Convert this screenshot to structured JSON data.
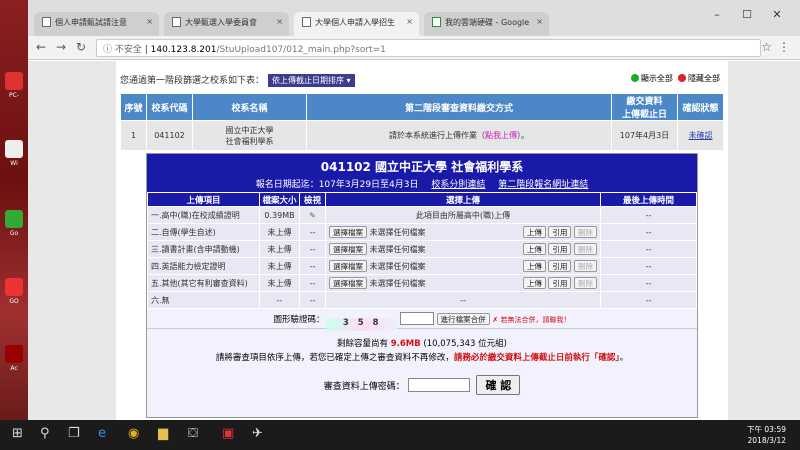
{
  "tabs": [
    {
      "label": "個人申請甄試請注意"
    },
    {
      "label": "大學甄選入學委員會"
    },
    {
      "label": "大學個人申請入學招生"
    },
    {
      "label": "我的雲端硬碟 - Google"
    }
  ],
  "address": {
    "warn": "ⓘ 不安全",
    "host": "140.123.8.201",
    "path": "/StuUpload107/012_main.php?sort=1"
  },
  "topline": {
    "text": "您通過第一階段篩選之校系如下表：",
    "sort": "依上傳截止日期排序 ▾"
  },
  "legend": {
    "show_all": "顯示全部",
    "hide_all": "隱藏全部",
    "show_color": "#22aa22",
    "hide_color": "#dd2222"
  },
  "schools": {
    "headers": [
      "序號",
      "校系代碼",
      "校系名稱",
      "第二階段審查資料繳交方式",
      "繳交資料\n上傳截止日",
      "確認狀態"
    ],
    "row": {
      "no": "1",
      "code": "041102",
      "name1": "國立中正大學",
      "name2": "社會福利學系",
      "method": "請於本系統進行上傳作業（",
      "method_link": "點我上傳",
      "method_end": "）。",
      "deadline": "107年4月3日",
      "status": "未確認"
    }
  },
  "detail": {
    "title": "041102 國立中正大學 社會福利學系",
    "subtitle": "報名日期起迄：107年3月29日至4月3日",
    "link1": "校系分則連結",
    "link2": "第二階段報名網址連結",
    "headers": [
      "上傳項目",
      "檔案大小",
      "檢視",
      "選擇上傳",
      "最後上傳時間"
    ],
    "rows": [
      {
        "item": "一.高中(職)在校成績證明",
        "size": "0.39MB",
        "view": "✎",
        "choose": "此項目由所屬高中(職)上傳",
        "time": "--"
      },
      {
        "item": "二.自傳(學生自述)",
        "size": "未上傳",
        "view": "--",
        "choose": "選擇檔案",
        "nofile": "未選擇任何檔案",
        "upload": "上傳",
        "cite": "引用",
        "del": "刪除",
        "time": "--"
      },
      {
        "item": "三.讀書計畫(含申請動機)",
        "size": "未上傳",
        "view": "--",
        "choose": "選擇檔案",
        "nofile": "未選擇任何檔案",
        "upload": "上傳",
        "cite": "引用",
        "del": "刪除",
        "time": "--"
      },
      {
        "item": "四.英語能力檢定證明",
        "size": "未上傳",
        "view": "--",
        "choose": "選擇檔案",
        "nofile": "未選擇任何檔案",
        "upload": "上傳",
        "cite": "引用",
        "del": "刪除",
        "time": "--"
      },
      {
        "item": "五.其他(其它有利審查資料)",
        "size": "未上傳",
        "view": "--",
        "choose": "選擇檔案",
        "nofile": "未選擇任何檔案",
        "upload": "上傳",
        "cite": "引用",
        "del": "刪除",
        "time": "--"
      },
      {
        "item": "六.無",
        "size": "--",
        "view": "--",
        "choose": "--",
        "time": "--"
      }
    ],
    "captcha_label": "圖形驗證碼：",
    "captcha_text": "3 5 8",
    "merge_button": "進行檔案合併",
    "unknown_label": "若無法合併，請聯我！",
    "quota_prefix": "剩餘容量尚有 ",
    "quota_big": "9.6MB",
    "quota_suffix": " (10,075,343 位元組)",
    "notice_a": "請將審查項目依序上傳，若您已確定上傳之審查資料不再修改，",
    "notice_b": "請務必於繳交資料上傳截止日前執行「確認」",
    "notice_c": "。",
    "pw_label": "審查資料上傳密碼：",
    "confirm_button": "確 認"
  },
  "taskbar": {
    "time": "下午 03:59",
    "date": "2018/3/12"
  }
}
